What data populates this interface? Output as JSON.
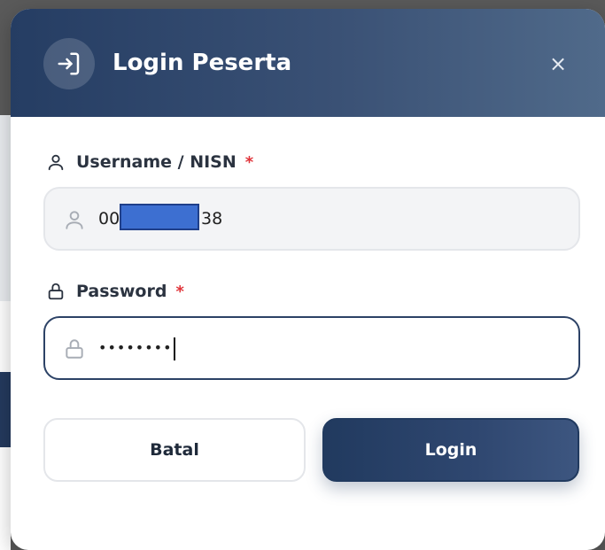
{
  "modal": {
    "title": "Login Peserta",
    "close_label": "×"
  },
  "form": {
    "username": {
      "label": "Username / NISN",
      "required_mark": "*",
      "value_prefix": "00",
      "value_suffix": "38",
      "icon": "user-icon"
    },
    "password": {
      "label": "Password",
      "required_mark": "*",
      "value_masked": "••••••••",
      "icon": "lock-icon"
    }
  },
  "actions": {
    "cancel_label": "Batal",
    "login_label": "Login"
  },
  "colors": {
    "header_start": "#253d63",
    "header_end": "#506a8a",
    "primary": "#213a5f",
    "required": "#e0343a",
    "redaction": "#3d6fd1"
  }
}
